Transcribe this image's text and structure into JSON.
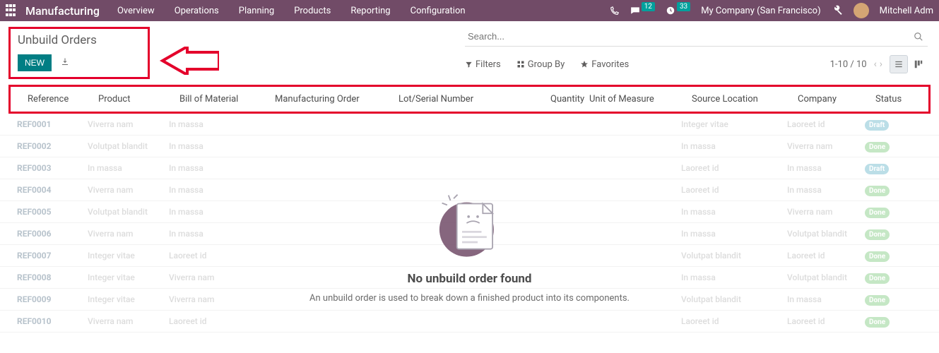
{
  "topbar": {
    "brand": "Manufacturing",
    "nav": [
      "Overview",
      "Operations",
      "Planning",
      "Products",
      "Reporting",
      "Configuration"
    ],
    "msg_badge": "12",
    "activity_badge": "33",
    "company": "My Company (San Francisco)",
    "user": "Mitchell Adm"
  },
  "page": {
    "title": "Unbuild Orders",
    "new_label": "NEW",
    "search_placeholder": "Search...",
    "filters": "Filters",
    "groupby": "Group By",
    "favorites": "Favorites",
    "pager": "1-10 / 10"
  },
  "columns": {
    "reference": "Reference",
    "product": "Product",
    "bom": "Bill of Material",
    "mo": "Manufacturing Order",
    "lot": "Lot/Serial Number",
    "qty": "Quantity",
    "uom": "Unit of Measure",
    "src": "Source Location",
    "company": "Company",
    "status": "Status"
  },
  "ghost": {
    "rows": [
      {
        "ref": "REF0001",
        "p": "Viverra nam",
        "b": "In massa",
        "src": "Integer vitae",
        "c": "Laoreet id",
        "st": "Draft",
        "cls": "st-draft"
      },
      {
        "ref": "REF0002",
        "p": "Volutpat blandit",
        "b": "In massa",
        "src": "In massa",
        "c": "Viverra nam",
        "st": "Done",
        "cls": "st-done"
      },
      {
        "ref": "REF0003",
        "p": "In massa",
        "b": "In massa",
        "src": "Laoreet id",
        "c": "In massa",
        "st": "Draft",
        "cls": "st-draft"
      },
      {
        "ref": "REF0004",
        "p": "Viverra nam",
        "b": "In massa",
        "src": "Laoreet id",
        "c": "In massa",
        "st": "Done",
        "cls": "st-done"
      },
      {
        "ref": "REF0005",
        "p": "Volutpat blandit",
        "b": "In massa",
        "src": "In massa",
        "c": "Viverra nam",
        "st": "Done",
        "cls": "st-done"
      },
      {
        "ref": "REF0006",
        "p": "Viverra nam",
        "b": "In massa",
        "src": "In massa",
        "c": "Volutpat blandit",
        "st": "Done",
        "cls": "st-done"
      },
      {
        "ref": "REF0007",
        "p": "Integer vitae",
        "b": "Laoreet id",
        "src": "Volutpat blandit",
        "c": "Laoreet id",
        "st": "Done",
        "cls": "st-done"
      },
      {
        "ref": "REF0008",
        "p": "Integer vitae",
        "b": "Viverra nam",
        "src": "In massa",
        "c": "Volutpat blandit",
        "st": "Done",
        "cls": "st-done"
      },
      {
        "ref": "REF0009",
        "p": "Integer vitae",
        "b": "Viverra nam",
        "src": "Volutpat blandit",
        "c": "In massa",
        "st": "Done",
        "cls": "st-done"
      },
      {
        "ref": "REF0010",
        "p": "Viverra nam",
        "b": "Laoreet id",
        "src": "Laoreet id",
        "c": "Laoreet id",
        "st": "Done",
        "cls": "st-done"
      }
    ]
  },
  "empty": {
    "heading": "No unbuild order found",
    "text": "An unbuild order is used to break down a finished product into its components."
  }
}
